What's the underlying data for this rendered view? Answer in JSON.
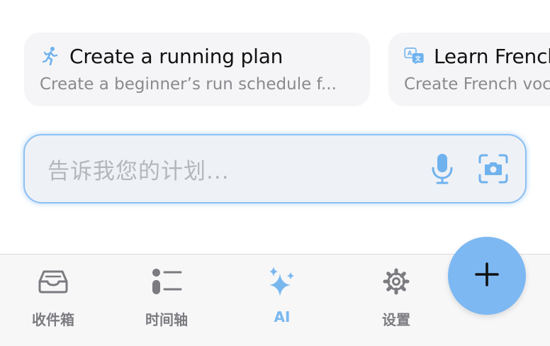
{
  "suggestions": [
    {
      "icon": "running-person-icon",
      "title": "Create a running plan",
      "subtitle": "Create a beginner’s run schedule f..."
    },
    {
      "icon": "translate-icon",
      "title": "Learn French",
      "subtitle": "Create French vocabulary"
    }
  ],
  "input": {
    "placeholder": "告诉我您的计划..."
  },
  "tabbar": {
    "tabs": [
      {
        "icon": "inbox-icon",
        "label": "收件箱"
      },
      {
        "icon": "timeline-icon",
        "label": "时间轴"
      },
      {
        "icon": "sparkles-icon",
        "label": "AI",
        "active": true
      },
      {
        "icon": "gear-icon",
        "label": "设置"
      }
    ]
  },
  "fab": {
    "icon": "plus-icon"
  },
  "colors": {
    "accent": "#7db8f2",
    "inactive": "#7b7b80",
    "card_bg": "#f5f5f7"
  }
}
